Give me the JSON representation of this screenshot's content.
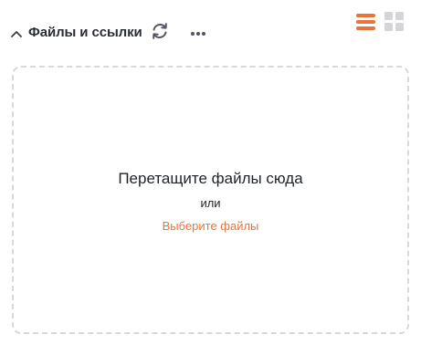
{
  "header": {
    "title": "Файлы и ссылки",
    "collapse_icon": "chevron-up-icon",
    "refresh_icon": "refresh-icon",
    "more_icon": "more-horizontal-icon",
    "view_list_icon": "list-view-icon",
    "view_grid_icon": "grid-view-icon"
  },
  "dropzone": {
    "title": "Перетащите файлы сюда",
    "or_text": "или",
    "select_link": "Выберите файлы"
  },
  "colors": {
    "accent": "#e8743b",
    "icon_gray": "#505560",
    "inactive_gray": "#d3d5d9",
    "border": "#d6d8dc"
  }
}
